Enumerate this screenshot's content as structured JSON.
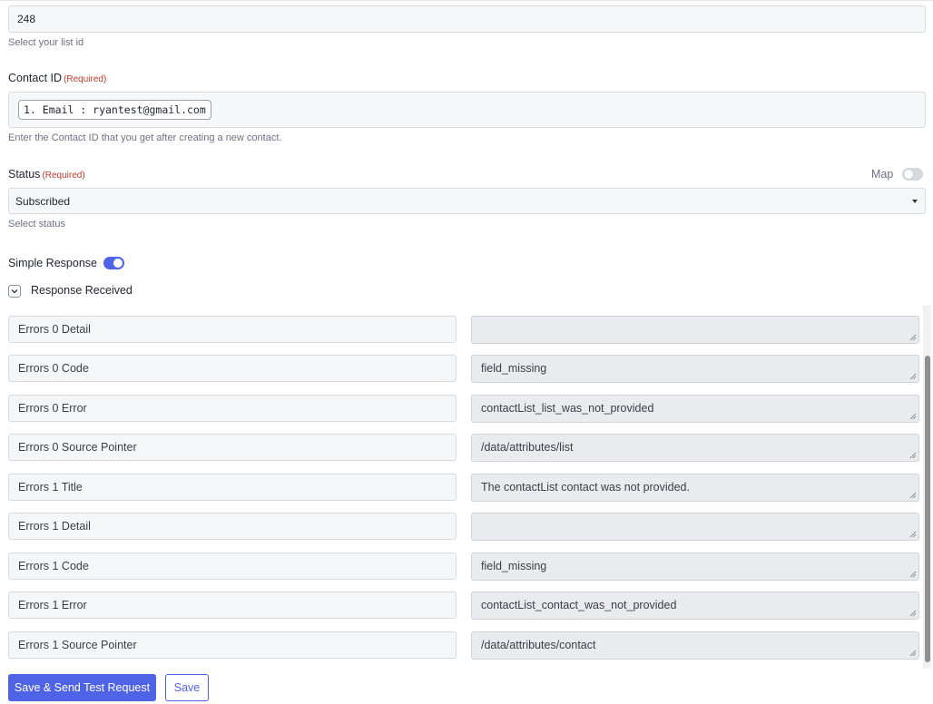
{
  "list": {
    "value": "248",
    "hint": "Select your list id"
  },
  "contact": {
    "label": "Contact ID",
    "required": "(Required)",
    "pill": "1. Email : ryantest@gmail.com",
    "hint": "Enter the Contact ID that you get after creating a new contact."
  },
  "status": {
    "label": "Status",
    "required": "(Required)",
    "map_label": "Map",
    "value": "Subscribed",
    "hint": "Select status"
  },
  "simple_response": {
    "label": "Simple Response",
    "enabled": true
  },
  "response_received": {
    "label": "Response Received"
  },
  "rows": [
    {
      "key": "Errors 0 Detail",
      "value": ""
    },
    {
      "key": "Errors 0 Code",
      "value": "field_missing"
    },
    {
      "key": "Errors 0 Error",
      "value": "contactList_list_was_not_provided"
    },
    {
      "key": "Errors 0 Source Pointer",
      "value": "/data/attributes/list"
    },
    {
      "key": "Errors 1 Title",
      "value": "The contactList contact was not provided."
    },
    {
      "key": "Errors 1 Detail",
      "value": ""
    },
    {
      "key": "Errors 1 Code",
      "value": "field_missing"
    },
    {
      "key": "Errors 1 Error",
      "value": "contactList_contact_was_not_provided"
    },
    {
      "key": "Errors 1 Source Pointer",
      "value": "/data/attributes/contact"
    }
  ],
  "buttons": {
    "save_send": "Save & Send Test Request",
    "save": "Save"
  },
  "colors": {
    "accent": "#4f63e7",
    "required": "#c0392b"
  }
}
